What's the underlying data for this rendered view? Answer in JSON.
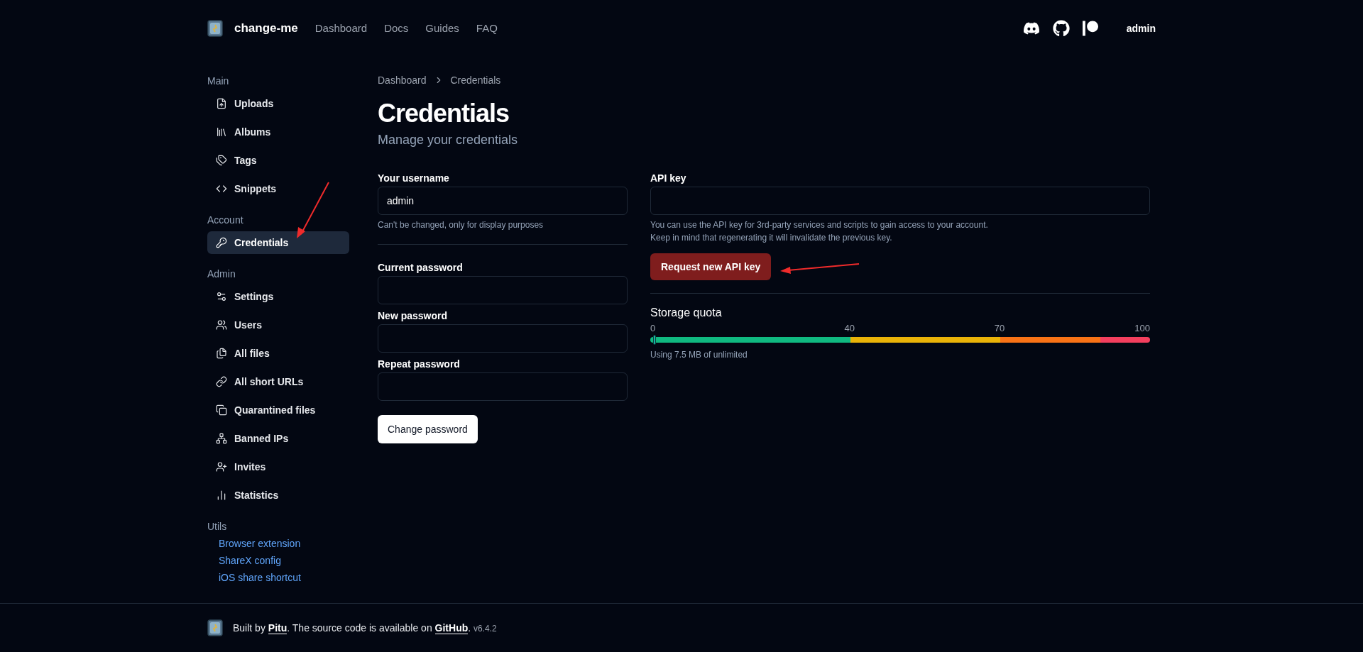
{
  "header": {
    "brand": "change-me",
    "nav": [
      "Dashboard",
      "Docs",
      "Guides",
      "FAQ"
    ],
    "user": "admin"
  },
  "sidebar": {
    "sections": [
      {
        "title": "Main",
        "items": [
          {
            "label": "Uploads",
            "selected": false
          },
          {
            "label": "Albums",
            "selected": false
          },
          {
            "label": "Tags",
            "selected": false
          },
          {
            "label": "Snippets",
            "selected": false
          }
        ]
      },
      {
        "title": "Account",
        "items": [
          {
            "label": "Credentials",
            "selected": true
          }
        ]
      },
      {
        "title": "Admin",
        "items": [
          {
            "label": "Settings",
            "selected": false
          },
          {
            "label": "Users",
            "selected": false
          },
          {
            "label": "All files",
            "selected": false
          },
          {
            "label": "All short URLs",
            "selected": false
          },
          {
            "label": "Quarantined files",
            "selected": false
          },
          {
            "label": "Banned IPs",
            "selected": false
          },
          {
            "label": "Invites",
            "selected": false
          },
          {
            "label": "Statistics",
            "selected": false
          }
        ]
      }
    ],
    "utils": {
      "title": "Utils",
      "links": [
        "Browser extension",
        "ShareX config",
        "iOS share shortcut"
      ]
    }
  },
  "breadcrumb": [
    "Dashboard",
    "Credentials"
  ],
  "page": {
    "title": "Credentials",
    "subtitle": "Manage your credentials"
  },
  "username": {
    "label": "Your username",
    "value": "admin",
    "hint": "Can't be changed, only for display purposes"
  },
  "passwords": [
    {
      "label": "Current password"
    },
    {
      "label": "New password"
    },
    {
      "label": "Repeat password"
    }
  ],
  "change_button": "Change password",
  "api_key": {
    "label": "API key",
    "help": [
      "You can use the API key for 3rd-party services and scripts to gain access to your account.",
      "Keep in mind that regenerating it will invalidate the previous key."
    ],
    "button": "Request new API key"
  },
  "storage": {
    "title": "Storage quota",
    "ticks": [
      "0",
      "40",
      "70",
      "100"
    ],
    "level": 0.005,
    "usage": "Using 7.5 MB of unlimited"
  },
  "footer": {
    "parts": [
      {
        "kind": "text",
        "text": "Built by "
      },
      {
        "kind": "link",
        "text": "Pitu"
      },
      {
        "kind": "text",
        "text": ". The source code is available on "
      },
      {
        "kind": "link",
        "text": "GitHub"
      },
      {
        "kind": "text",
        "text": "."
      }
    ],
    "version": "v6.4.2"
  }
}
